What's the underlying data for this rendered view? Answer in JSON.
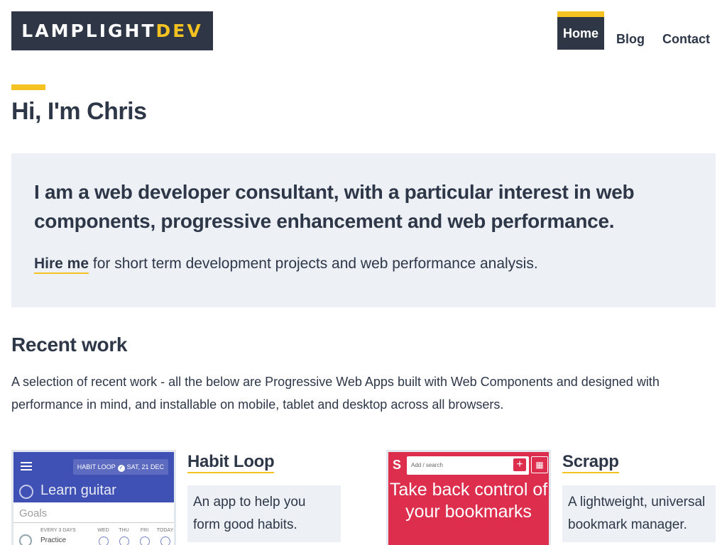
{
  "header": {
    "logo_main": "LAMPLIGHT",
    "logo_accent": "DEV",
    "colors": {
      "dark": "#2f3746",
      "accent": "#f4c221"
    },
    "nav": [
      {
        "label": "Home",
        "active": true
      },
      {
        "label": "Blog",
        "active": false
      },
      {
        "label": "Contact",
        "active": false
      }
    ]
  },
  "hero": {
    "title": "Hi, I'm Chris",
    "lead": "I am a web developer consultant, with a particular interest in web components, progressive enhancement and web performance.",
    "hire_link": "Hire me",
    "hire_rest": " for short term development projects and web performance analysis."
  },
  "recent": {
    "title": "Recent work",
    "description": "A selection of recent work - all the below are Progressive Web Apps built with Web Components and designed with performance in mind, and installable on mobile, tablet and desktop across all browsers.",
    "projects": [
      {
        "title": "Habit Loop",
        "description": "An app to help you form good habits.",
        "thumbnail": {
          "badge": "HABIT LOOP",
          "date": "SAT, 21 DEC",
          "input": "Learn guitar",
          "goals": "Goals",
          "meta": "EVERY 3 DAYS",
          "task": "Practice",
          "days": [
            "WED",
            "THU",
            "FRI",
            "TODAY"
          ]
        }
      },
      {
        "title": "Scrapp",
        "description": "A lightweight, universal bookmark manager.",
        "thumbnail": {
          "logo": "S",
          "search_placeholder": "Add / search",
          "plus": "+",
          "tagline": "Take back control of your bookmarks"
        }
      }
    ]
  }
}
